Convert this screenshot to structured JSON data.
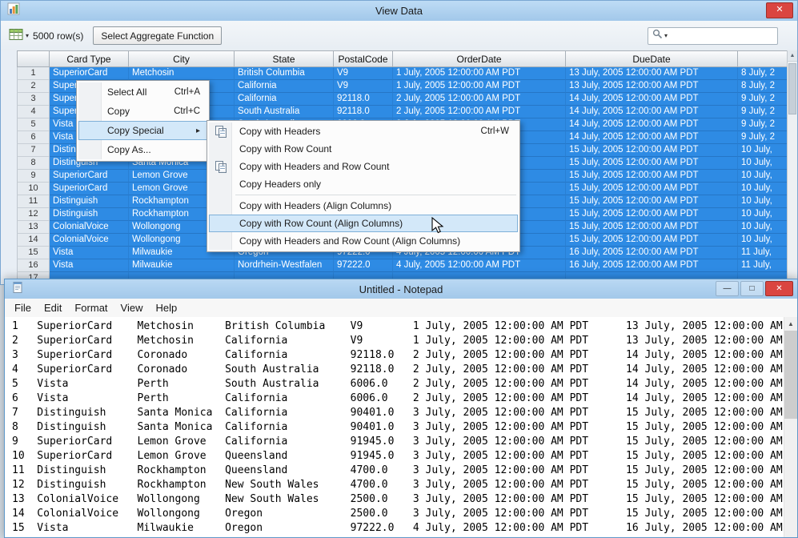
{
  "colors": {
    "titlebar": "#aecff0",
    "selection": "#2e8be4",
    "close_button": "#da4540",
    "menu_highlight": "#d3e8f9",
    "menu_highlight_border": "#7fb0d8"
  },
  "view_data_window": {
    "title": "View Data",
    "toolbar": {
      "row_count_label": "5000 row(s)",
      "aggregate_button_label": "Select Aggregate Function",
      "search_placeholder": ""
    },
    "grid": {
      "columns": [
        "Card Type",
        "City",
        "State",
        "PostalCode",
        "OrderDate",
        "DueDate"
      ],
      "rows": [
        {
          "num": "1",
          "card_type": "SuperiorCard",
          "city": "Metchosin",
          "state": "British Columbia",
          "postal_code": "V9",
          "order_date": "1 July, 2005 12:00:00 AM PDT",
          "due_date": "13 July, 2005 12:00:00 AM PDT",
          "ship_date": "8 July, 2"
        },
        {
          "num": "2",
          "card_type": "SuperiorCard",
          "city": "Metchosin",
          "state": "California",
          "postal_code": "V9",
          "order_date": "1 July, 2005 12:00:00 AM PDT",
          "due_date": "13 July, 2005 12:00:00 AM PDT",
          "ship_date": "8 July, 2"
        },
        {
          "num": "3",
          "card_type": "SuperiorCard",
          "city": "Coronado",
          "state": "California",
          "postal_code": "92118.0",
          "order_date": "2 July, 2005 12:00:00 AM PDT",
          "due_date": "14 July, 2005 12:00:00 AM PDT",
          "ship_date": "9 July, 2"
        },
        {
          "num": "4",
          "card_type": "SuperiorCard",
          "city": "Coronado",
          "state": "South Australia",
          "postal_code": "92118.0",
          "order_date": "2 July, 2005 12:00:00 AM PDT",
          "due_date": "14 July, 2005 12:00:00 AM PDT",
          "ship_date": "9 July, 2"
        },
        {
          "num": "5",
          "card_type": "Vista",
          "city": "Perth",
          "state": "South Australia",
          "postal_code": "6006.0",
          "order_date": "2 July, 2005 12:00:00 AM PDT",
          "due_date": "14 July, 2005 12:00:00 AM PDT",
          "ship_date": "9 July, 2"
        },
        {
          "num": "6",
          "card_type": "Vista",
          "city": "Perth",
          "state": "California",
          "postal_code": "6006.0",
          "order_date": "2 July, 2005 12:00:00 AM PDT",
          "due_date": "14 July, 2005 12:00:00 AM PDT",
          "ship_date": "9 July, 2"
        },
        {
          "num": "7",
          "card_type": "Distinguish",
          "city": "Santa Monica",
          "state": "California",
          "postal_code": "90401.0",
          "order_date": "3 July, 2005 12:00:00 AM PDT",
          "due_date": "15 July, 2005 12:00:00 AM PDT",
          "ship_date": "10 July,"
        },
        {
          "num": "8",
          "card_type": "Distinguish",
          "city": "Santa Monica",
          "state": "California",
          "postal_code": "90401.0",
          "order_date": "3 July, 2005 12:00:00 AM PDT",
          "due_date": "15 July, 2005 12:00:00 AM PDT",
          "ship_date": "10 July,"
        },
        {
          "num": "9",
          "card_type": "SuperiorCard",
          "city": "Lemon Grove",
          "state": "California",
          "postal_code": "91945.0",
          "order_date": "3 July, 2005 12:00:00 AM PDT",
          "due_date": "15 July, 2005 12:00:00 AM PDT",
          "ship_date": "10 July,"
        },
        {
          "num": "10",
          "card_type": "SuperiorCard",
          "city": "Lemon Grove",
          "state": "Queensland",
          "postal_code": "91945.0",
          "order_date": "3 July, 2005 12:00:00 AM PDT",
          "due_date": "15 July, 2005 12:00:00 AM PDT",
          "ship_date": "10 July,"
        },
        {
          "num": "11",
          "card_type": "Distinguish",
          "city": "Rockhampton",
          "state": "Queensland",
          "postal_code": "4700.0",
          "order_date": "3 July, 2005 12:00:00 AM PDT",
          "due_date": "15 July, 2005 12:00:00 AM PDT",
          "ship_date": "10 July,"
        },
        {
          "num": "12",
          "card_type": "Distinguish",
          "city": "Rockhampton",
          "state": "New South Wales",
          "postal_code": "4700.0",
          "order_date": "3 July, 2005 12:00:00 AM PDT",
          "due_date": "15 July, 2005 12:00:00 AM PDT",
          "ship_date": "10 July,"
        },
        {
          "num": "13",
          "card_type": "ColonialVoice",
          "city": "Wollongong",
          "state": "New South Wales",
          "postal_code": "2500.0",
          "order_date": "3 July, 2005 12:00:00 AM PDT",
          "due_date": "15 July, 2005 12:00:00 AM PDT",
          "ship_date": "10 July,"
        },
        {
          "num": "14",
          "card_type": "ColonialVoice",
          "city": "Wollongong",
          "state": "Oregon",
          "postal_code": "2500.0",
          "order_date": "3 July, 2005 12:00:00 AM PDT",
          "due_date": "15 July, 2005 12:00:00 AM PDT",
          "ship_date": "10 July,"
        },
        {
          "num": "15",
          "card_type": "Vista",
          "city": "Milwaukie",
          "state": "Oregon",
          "postal_code": "97222.0",
          "order_date": "4 July, 2005 12:00:00 AM PDT",
          "due_date": "16 July, 2005 12:00:00 AM PDT",
          "ship_date": "11 July,"
        },
        {
          "num": "16",
          "card_type": "Vista",
          "city": "Milwaukie",
          "state": "Nordrhein-Westfalen",
          "postal_code": "97222.0",
          "order_date": "4 July, 2005 12:00:00 AM PDT",
          "due_date": "16 July, 2005 12:00:00 AM PDT",
          "ship_date": "11 July,"
        },
        {
          "num": "17",
          "card_type": "",
          "city": "",
          "state": "",
          "postal_code": "",
          "order_date": "",
          "due_date": "",
          "ship_date": ""
        }
      ]
    }
  },
  "context_menu": {
    "items": [
      {
        "label": "Select All",
        "shortcut": "Ctrl+A"
      },
      {
        "label": "Copy",
        "shortcut": "Ctrl+C"
      },
      {
        "label": "Copy Special",
        "has_submenu": true,
        "highlighted": true
      },
      {
        "label": "Copy As..."
      }
    ]
  },
  "copy_special_submenu": {
    "items": [
      {
        "label": "Copy with Headers",
        "shortcut": "Ctrl+W",
        "icon": "copy-with-headers-icon"
      },
      {
        "label": "Copy with Row Count"
      },
      {
        "label": "Copy with Headers and Row Count",
        "icon": "copy-with-headers-and-row-count-icon"
      },
      {
        "label": "Copy Headers only"
      },
      {
        "separator": true
      },
      {
        "label": "Copy with Headers (Align Columns)"
      },
      {
        "label": "Copy with Row Count (Align Columns)",
        "highlighted": true
      },
      {
        "label": "Copy with Headers and Row Count (Align Columns)"
      }
    ]
  },
  "notepad_window": {
    "title": "Untitled - Notepad",
    "menu_items": [
      "File",
      "Edit",
      "Format",
      "View",
      "Help"
    ],
    "visible_row_count": 15
  }
}
